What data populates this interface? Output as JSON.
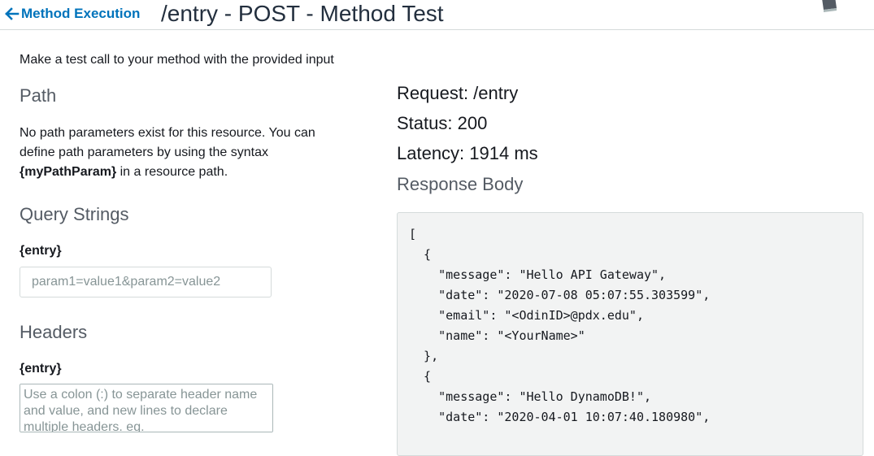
{
  "header": {
    "back_label": "Method Execution",
    "title": "/entry - POST - Method Test"
  },
  "intro": "Make a test call to your method with the provided input",
  "path": {
    "heading": "Path",
    "desc_pre": "No path parameters exist for this resource. You can define path parameters by using the syntax ",
    "desc_bold": "{myPathParam}",
    "desc_post": " in a resource path."
  },
  "query_strings": {
    "heading": "Query Strings",
    "label": "{entry}",
    "value": "",
    "placeholder": "param1=value1&param2=value2"
  },
  "headers": {
    "heading": "Headers",
    "label": "{entry}",
    "value": "",
    "placeholder": "Use a colon (:) to separate header name and value, and new lines to declare multiple headers. eg. Accept:application/json"
  },
  "result": {
    "request": "Request: /entry",
    "status": "Status: 200",
    "latency": "Latency: 1914 ms",
    "response_heading": "Response Body",
    "response_body": "[\n  {\n    \"message\": \"Hello API Gateway\",\n    \"date\": \"2020-07-08 05:07:55.303599\",\n    \"email\": \"<OdinID>@pdx.edu\",\n    \"name\": \"<YourName>\"\n  },\n  {\n    \"message\": \"Hello DynamoDB!\",\n    \"date\": \"2020-04-01 10:07:40.180980\","
  },
  "icons": {
    "back": "arrow-left-icon",
    "docs": "book-icon"
  },
  "colors": {
    "link": "#0073bb",
    "heading": "#545b64",
    "code_bg": "#f2f3f3",
    "border": "#d5dbdb"
  }
}
